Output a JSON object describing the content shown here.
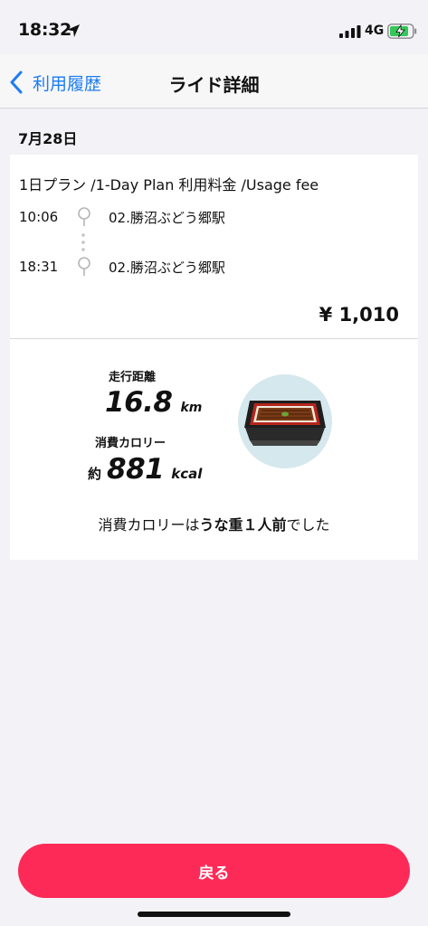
{
  "status_bar": {
    "time": "18:32",
    "network": "4G",
    "icons": [
      "location-arrow-icon",
      "signal-icon",
      "battery-charging-icon"
    ]
  },
  "nav": {
    "back_label": "利用履歴",
    "title": "ライド詳細",
    "back_icon": "chevron-left-icon"
  },
  "date": "7月28日",
  "ride": {
    "plan": "1日プラン /1-Day Plan 利用料金 /Usage fee",
    "start": {
      "time": "10:06",
      "station": "02.勝沼ぶどう郷駅"
    },
    "end": {
      "time": "18:31",
      "station": "02.勝沼ぶどう郷駅"
    },
    "fee": "¥ 1,010"
  },
  "stats": {
    "distance_label": "走行距離",
    "distance_value": "16.8",
    "distance_unit": "km",
    "calorie_label": "消費カロリー",
    "calorie_prefix": "約",
    "calorie_value": "881",
    "calorie_unit": "kcal",
    "summary_pre": "消費カロリーは",
    "summary_food": "うな重１人前",
    "summary_post": "でした"
  },
  "button": {
    "return_label": "戻る"
  },
  "colors": {
    "accent": "#1c7cf4",
    "button": "#fd2a57",
    "food_circle": "#d5e8ee"
  }
}
